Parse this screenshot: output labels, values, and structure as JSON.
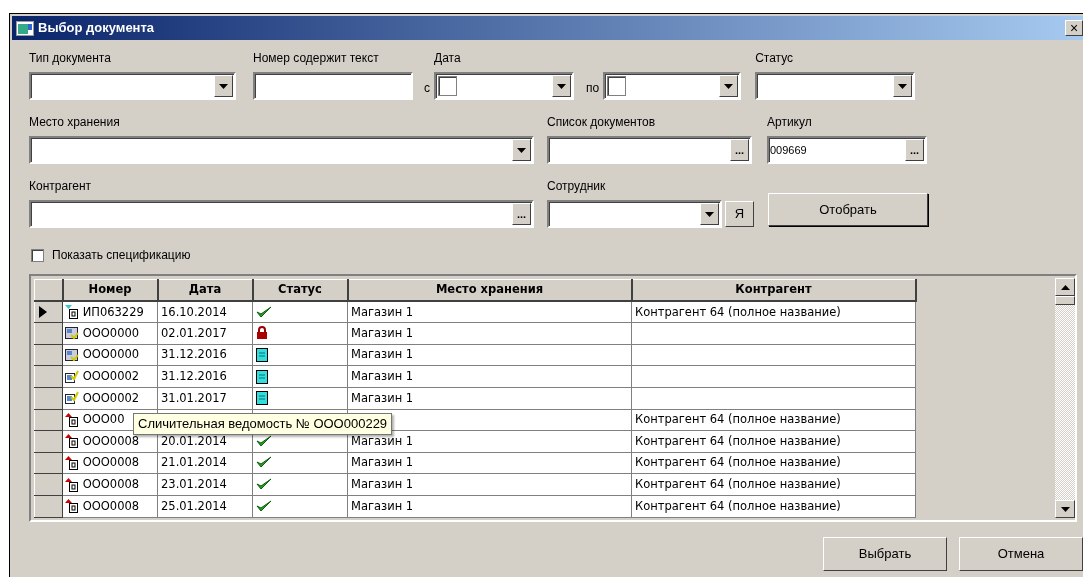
{
  "window": {
    "title": "Выбор документа",
    "close": "×"
  },
  "filters": {
    "doc_type": {
      "label": "Тип документа"
    },
    "number": {
      "label": "Номер содержит текст"
    },
    "date": {
      "label": "Дата",
      "from": "с",
      "to": "по",
      "from_checked": false,
      "to_checked": false
    },
    "status": {
      "label": "Статус"
    },
    "storage": {
      "label": "Место хранения"
    },
    "doc_list": {
      "label": "Список документов",
      "button": "..."
    },
    "article": {
      "label": "Артикул",
      "value": "009669",
      "button": "..."
    },
    "counterparty": {
      "label": "Контрагент",
      "button": "..."
    },
    "employee": {
      "label": "Сотрудник",
      "me_button": "Я"
    },
    "apply_button": "Отобрать",
    "show_spec": {
      "label": "Показать спецификацию",
      "checked": false
    }
  },
  "table": {
    "columns": [
      "Номер",
      "Дата",
      "Статус",
      "Место хранения",
      "Контрагент"
    ],
    "rows": [
      {
        "current": true,
        "doc_icon": {
          "kind": "cyan-arrow"
        },
        "number": "ИП063229",
        "date": "16.10.2014",
        "status_icon": {
          "kind": "done"
        },
        "storage": "Магазин 1",
        "counterparty": "Контрагент 64 (полное название)"
      },
      {
        "current": false,
        "doc_icon": {
          "kind": "form"
        },
        "number": "ООО0000",
        "date": "02.01.2017",
        "status_icon": {
          "kind": "locked"
        },
        "storage": "Магазин 1"
      },
      {
        "current": false,
        "doc_icon": {
          "kind": "form"
        },
        "number": "ООО0000",
        "date": "31.12.2016",
        "status_icon": {
          "kind": "draft"
        },
        "storage": "Магазин 1"
      },
      {
        "current": false,
        "doc_icon": {
          "kind": "checked"
        },
        "number": "ООО0002",
        "date": "31.12.2016",
        "status_icon": {
          "kind": "draft"
        },
        "storage": "Магазин 1"
      },
      {
        "current": false,
        "doc_icon": {
          "kind": "checked"
        },
        "number": "ООО0002",
        "date": "31.01.2017",
        "status_icon": {
          "kind": "draft"
        },
        "storage": "Магазин 1"
      },
      {
        "current": false,
        "doc_icon": {
          "kind": "red-arrow"
        },
        "number": "ООО00",
        "counterparty": "Контрагент 64 (полное название)"
      },
      {
        "current": false,
        "doc_icon": {
          "kind": "red-arrow"
        },
        "number": "ООО0008",
        "date": "20.01.2014",
        "status_icon": {
          "kind": "done"
        },
        "storage": "Магазин 1",
        "counterparty": "Контрагент 64 (полное название)"
      },
      {
        "current": false,
        "doc_icon": {
          "kind": "red-arrow"
        },
        "number": "ООО0008",
        "date": "21.01.2014",
        "status_icon": {
          "kind": "done"
        },
        "storage": "Магазин 1",
        "counterparty": "Контрагент 64 (полное название)"
      },
      {
        "current": false,
        "doc_icon": {
          "kind": "red-arrow"
        },
        "number": "ООО0008",
        "date": "23.01.2014",
        "status_icon": {
          "kind": "done"
        },
        "storage": "Магазин 1",
        "counterparty": "Контрагент 64 (полное название)"
      },
      {
        "current": false,
        "doc_icon": {
          "kind": "red-arrow"
        },
        "number": "ООО0008",
        "date": "25.01.2014",
        "status_icon": {
          "kind": "done"
        },
        "storage": "Магазин 1",
        "counterparty": "Контрагент 64 (полное название)"
      }
    ],
    "tooltip": "Сличительная ведомость № ООО000229"
  },
  "buttons": [
    "Выбрать",
    "Отмена"
  ]
}
